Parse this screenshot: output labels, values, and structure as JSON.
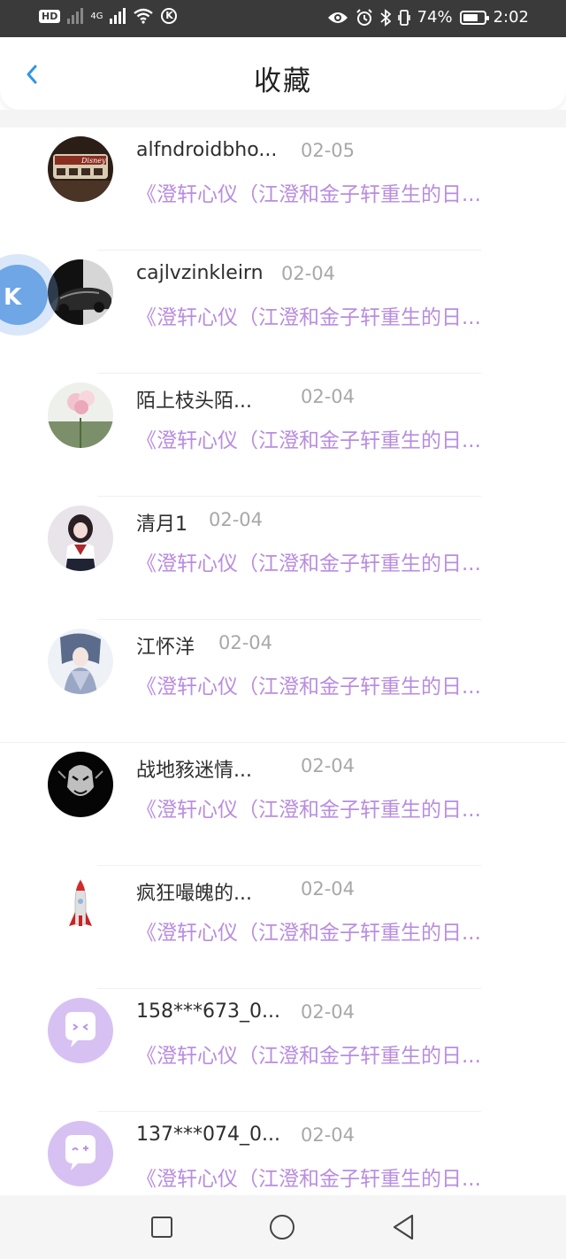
{
  "status_bar": {
    "hd_label": "HD",
    "signal_labels": [
      "4G"
    ],
    "battery_percent_text": "74%",
    "battery_level": 0.74,
    "time": "2:02"
  },
  "header": {
    "title": "收藏",
    "back_icon": "chevron-left-icon",
    "accent_color": "#2f96e3"
  },
  "list": {
    "items": [
      {
        "name": "alfndroidbho...",
        "date": "02-05",
        "book": "《澄轩心仪（江澄和金子轩重生的日..."
      },
      {
        "name": "cajlvzinkleirn",
        "date": "02-04",
        "book": "《澄轩心仪（江澄和金子轩重生的日..."
      },
      {
        "name": "陌上枝头陌...",
        "date": "02-04",
        "book": "《澄轩心仪（江澄和金子轩重生的日..."
      },
      {
        "name": "清月1",
        "date": "02-04",
        "book": "《澄轩心仪（江澄和金子轩重生的日..."
      },
      {
        "name": "江怀洋",
        "date": "02-04",
        "book": "《澄轩心仪（江澄和金子轩重生的日..."
      },
      {
        "name": "战地豥迷情...",
        "date": "02-04",
        "book": "《澄轩心仪（江澄和金子轩重生的日..."
      },
      {
        "name": "疯狂嘬魄的...",
        "date": "02-04",
        "book": "《澄轩心仪（江澄和金子轩重生的日..."
      },
      {
        "name": "158***673_0...",
        "date": "02-04",
        "book": "《澄轩心仪（江澄和金子轩重生的日..."
      },
      {
        "name": "137***074_0...",
        "date": "02-04",
        "book": "《澄轩心仪（江澄和金子轩重生的日..."
      }
    ],
    "book_color": "#b98de0"
  },
  "nav_bar": {
    "icons": [
      "square-recent-icon",
      "circle-home-icon",
      "triangle-back-icon"
    ]
  }
}
